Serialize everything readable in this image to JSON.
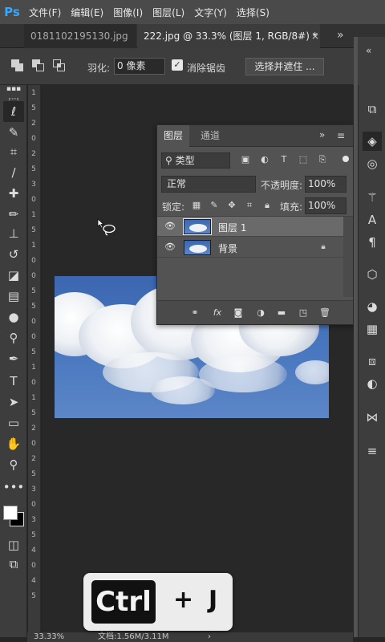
{
  "app": {
    "logo": "Ps",
    "accent": "#31a8ff"
  },
  "menu": [
    "文件(F)",
    "编辑(E)",
    "图像(I)",
    "图层(L)",
    "文字(Y)",
    "选择(S)"
  ],
  "tabs": {
    "inactive": "0181102195130.jpg",
    "active": "222.jpg @ 33.3% (图层 1, RGB/8#) *",
    "close": "×",
    "more": "»"
  },
  "options": {
    "feather_label": "羽化:",
    "feather_value": "0 像素",
    "antialias_checked": "✓",
    "antialias_label": "消除锯齿",
    "select_mask": "选择并遮住 ..."
  },
  "tools": [
    {
      "icon": "rect-marquee-icon",
      "glyph": "⬚"
    },
    {
      "icon": "lasso-icon",
      "glyph": "ℓ"
    },
    {
      "icon": "quick-select-icon",
      "glyph": "✎"
    },
    {
      "icon": "crop-icon",
      "glyph": "⌗"
    },
    {
      "icon": "eyedropper-icon",
      "glyph": "∕"
    },
    {
      "icon": "healing-brush-icon",
      "glyph": "✚"
    },
    {
      "icon": "brush-icon",
      "glyph": "✏"
    },
    {
      "icon": "stamp-icon",
      "glyph": "⊥"
    },
    {
      "icon": "history-brush-icon",
      "glyph": "↺"
    },
    {
      "icon": "eraser-icon",
      "glyph": "◪"
    },
    {
      "icon": "gradient-icon",
      "glyph": "▤"
    },
    {
      "icon": "blur-icon",
      "glyph": "●"
    },
    {
      "icon": "dodge-icon",
      "glyph": "⚲"
    },
    {
      "icon": "pen-icon",
      "glyph": "✒"
    },
    {
      "icon": "type-icon",
      "glyph": "T"
    },
    {
      "icon": "path-select-icon",
      "glyph": "➤"
    },
    {
      "icon": "shape-icon",
      "glyph": "▭"
    },
    {
      "icon": "hand-icon",
      "glyph": "✋"
    },
    {
      "icon": "zoom-icon",
      "glyph": "⚲"
    },
    {
      "icon": "more-tools-icon",
      "glyph": "•••"
    }
  ],
  "ruler": [
    "1",
    "5",
    "2",
    "0",
    "2",
    "5",
    "3",
    "0",
    "1",
    "5",
    "1",
    "0",
    "0",
    "5",
    "5",
    "0",
    "0",
    "5",
    "1",
    "0",
    "1",
    "5",
    "2",
    "0",
    "2",
    "5",
    "3",
    "0",
    "3",
    "5",
    "4",
    "0",
    "4",
    "5"
  ],
  "right_tools": [
    {
      "icon": "history-panel-icon",
      "glyph": "⧉"
    },
    {
      "icon": "layers-panel-icon",
      "glyph": "◈"
    },
    {
      "icon": "channels-panel-icon",
      "glyph": "◎"
    },
    {
      "icon": "brush-panel-icon",
      "glyph": "⚚"
    },
    {
      "icon": "character-panel-icon",
      "glyph": "A"
    },
    {
      "icon": "paragraph-panel-icon",
      "glyph": "¶"
    },
    {
      "icon": "3d-panel-icon",
      "glyph": "⬡"
    },
    {
      "icon": "swatches-panel-icon",
      "glyph": "◕"
    },
    {
      "icon": "grid-panel-icon",
      "glyph": "▦"
    },
    {
      "icon": "properties-panel-icon",
      "glyph": "⧈"
    },
    {
      "icon": "adjustments-panel-icon",
      "glyph": "◐"
    },
    {
      "icon": "paths-panel-icon",
      "glyph": "⋈"
    },
    {
      "icon": "sliders-panel-icon",
      "glyph": "≡"
    }
  ],
  "layers_panel": {
    "tab_active": "图层",
    "tab_inactive": "通道",
    "more": "»",
    "menu": "≡",
    "filter": "⚲ 类型",
    "blend_mode": "正常",
    "opacity_label": "不透明度:",
    "opacity_value": "100%",
    "lock_label": "锁定:",
    "fill_label": "填充:",
    "fill_value": "100%",
    "layers": [
      {
        "name": "图层 1",
        "selected": true,
        "locked": false
      },
      {
        "name": "背景",
        "selected": false,
        "locked": true
      }
    ],
    "footer_icons": [
      "link-icon",
      "fx-icon",
      "mask-icon",
      "adjustment-icon",
      "folder-icon",
      "new-layer-icon",
      "trash-icon"
    ],
    "fx_label": "fx"
  },
  "status": {
    "zoom": "33.33%",
    "doc": "文档:1.56M/3.11M",
    "arrow": "›"
  },
  "shortcut": {
    "key1": "Ctrl",
    "plus": "+",
    "key2": "J"
  }
}
